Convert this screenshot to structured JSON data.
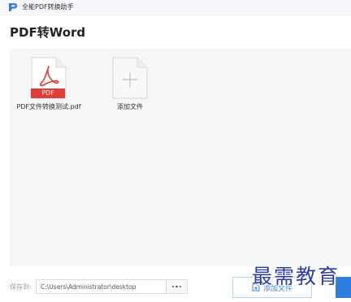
{
  "app": {
    "title": "全能PDF转换助手"
  },
  "page": {
    "title": "PDF转Word"
  },
  "files": [
    {
      "name": "PDF文件转换测试.pdf",
      "badge": "PDF"
    }
  ],
  "add_tile": {
    "label": "添加文件"
  },
  "save": {
    "label": "保存到:",
    "path": "C:\\Users\\Administrator\\desktop",
    "browse_icon": "more-dots-icon"
  },
  "footer": {
    "add_button_label": "添加文件"
  },
  "watermark": {
    "text": "最需教育"
  },
  "colors": {
    "accent": "#2f7de1",
    "pdf_red": "#e33b36",
    "file_area_bg": "#f5f6f8",
    "watermark": "#2c3fa0"
  }
}
